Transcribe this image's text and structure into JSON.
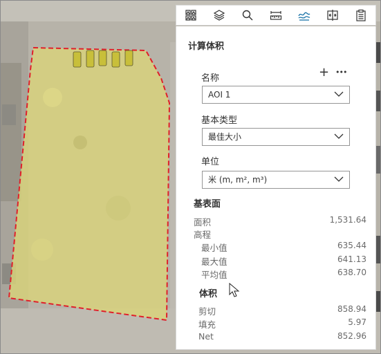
{
  "toolbar": {
    "tools": [
      {
        "icon": "basemap-gallery-icon"
      },
      {
        "icon": "layers-icon"
      },
      {
        "icon": "search-icon"
      },
      {
        "icon": "measure-distance-icon"
      },
      {
        "icon": "elevation-profile-icon"
      },
      {
        "icon": "swipe-compare-icon"
      },
      {
        "icon": "clipboard-icon"
      }
    ],
    "active_index": 4
  },
  "panel": {
    "title": "计算体积",
    "add_icon": "+",
    "more_icon": "•••",
    "name_label": "名称",
    "name_value": "AOI 1",
    "base_type_label": "基本类型",
    "base_type_value": "最佳大小",
    "unit_label": "单位",
    "unit_value": "米 (m, m², m³)"
  },
  "base_surface": {
    "title": "基表面",
    "area_label": "面积",
    "area_value": "1,531.64",
    "elevation_label": "高程",
    "min_label": "最小值",
    "min_value": "635.44",
    "max_label": "最大值",
    "max_value": "641.13",
    "avg_label": "平均值",
    "avg_value": "638.70"
  },
  "volume": {
    "title": "体积",
    "cut_label": "剪切",
    "cut_value": "858.94",
    "fill_label": "填充",
    "fill_value": "5.97",
    "net_label": "Net",
    "net_value": "852.96"
  },
  "colors": {
    "aoi_fill": "#d9d37a",
    "aoi_outline": "#e0202a",
    "active_tool": "#1a73a8"
  }
}
